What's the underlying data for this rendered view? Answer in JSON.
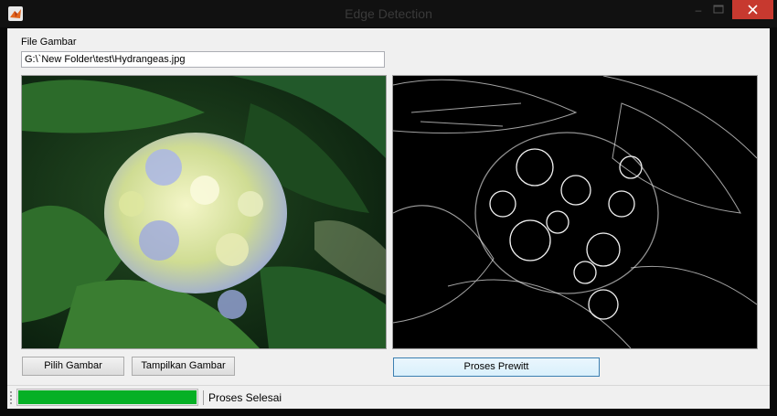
{
  "window": {
    "title": "Edge Detection",
    "minimize_label": "–",
    "app_icon": "matlab-icon"
  },
  "form": {
    "file_label": "File Gambar",
    "file_path": "G:\\`New Folder\\test\\Hydrangeas.jpg"
  },
  "images": {
    "original": "hydrangea-photo",
    "edges": "prewitt-edge-result"
  },
  "buttons": {
    "choose": "Pilih Gambar",
    "show": "Tampilkan Gambar",
    "prewitt": "Proses Prewitt"
  },
  "status": {
    "progress": 1.0,
    "text": "Proses Selesai",
    "progress_color": "#06b025"
  },
  "colors": {
    "close_button": "#c7392f",
    "title_bar": "#111111"
  }
}
